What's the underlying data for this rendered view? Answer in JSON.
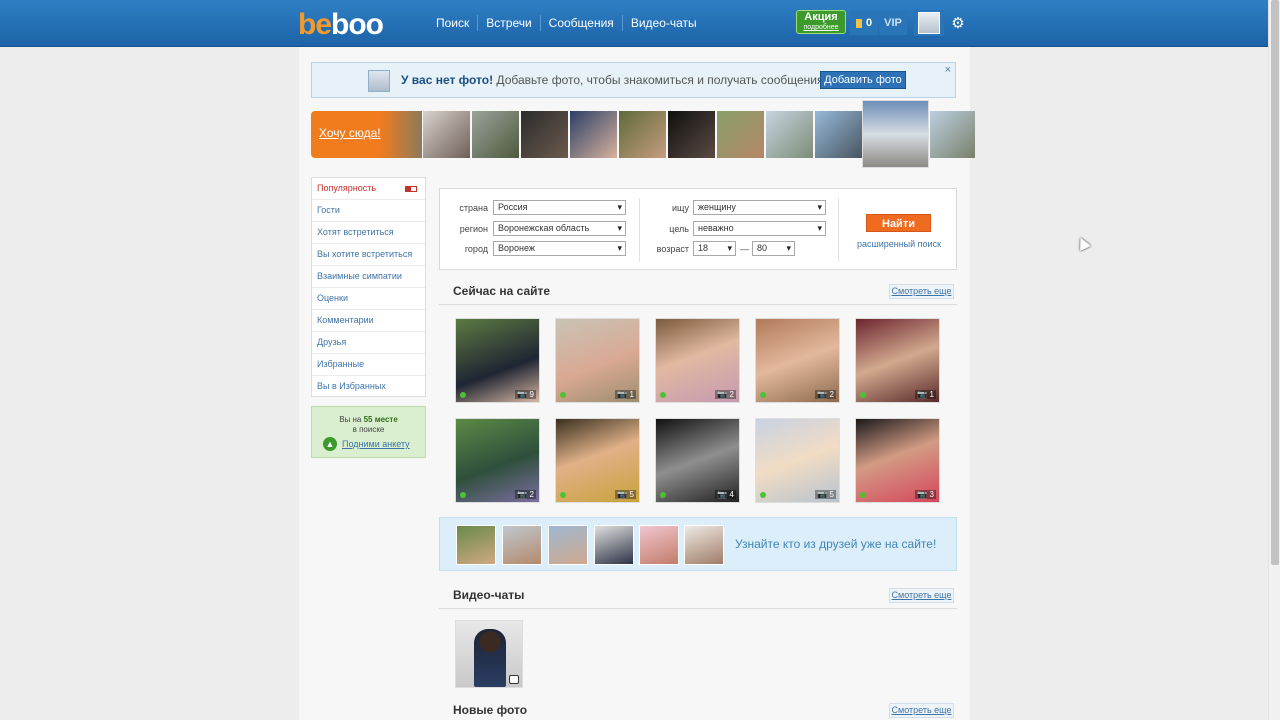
{
  "header": {
    "logo_text_left": "be",
    "logo_text_right": "boo",
    "nav": [
      "Поиск",
      "Встречи",
      "Сообщения",
      "Видео-чаты"
    ],
    "promo_title": "Акция",
    "promo_sub": "подробнее",
    "coins": "0",
    "vip": "VIP"
  },
  "notice": {
    "bold": "У вас нет фото!",
    "text": " Добавьте фото, чтобы знакомиться и получать сообщения",
    "button": "Добавить фото",
    "close": "×"
  },
  "strip": {
    "want_label": "Хочу сюда!"
  },
  "menu": {
    "items": [
      "Популярность",
      "Гости",
      "Хотят встретиться",
      "Вы хотите встретиться",
      "Взаимные симпатии",
      "Оценки",
      "Комментарии",
      "Друзья",
      "Избранные",
      "Вы в Избранных"
    ]
  },
  "rank": {
    "line1_prefix": "Вы на ",
    "place": "55 месте",
    "line2": "в поиске",
    "link": "Подними анкету"
  },
  "search": {
    "country_label": "страна",
    "country": "Россия",
    "region_label": "регион",
    "region": "Воронежская область",
    "city_label": "город",
    "city": "Воронеж",
    "seek_label": "ищу",
    "seek": "женщину",
    "goal_label": "цель",
    "goal": "неважно",
    "age_label": "возраст",
    "age_from": "18",
    "age_dash": "—",
    "age_to": "80",
    "find": "Найти",
    "advanced": "расширенный поиск"
  },
  "online": {
    "title": "Сейчас на сайте",
    "more": "Смотреть еще",
    "counts": [
      "9",
      "1",
      "2",
      "2",
      "1",
      "2",
      "5",
      "4",
      "5",
      "3"
    ]
  },
  "friends": {
    "text": "Узнайте кто из друзей уже на сайте!"
  },
  "video": {
    "title": "Видео-чаты",
    "more": "Смотреть еще"
  },
  "new_photos": {
    "title": "Новые фото",
    "more": "Смотреть еще"
  },
  "colors": {
    "header_blue": "#1d63a8",
    "accent_orange": "#ef6b1f",
    "link_blue": "#3d74a9",
    "online_green": "#4cc233"
  }
}
